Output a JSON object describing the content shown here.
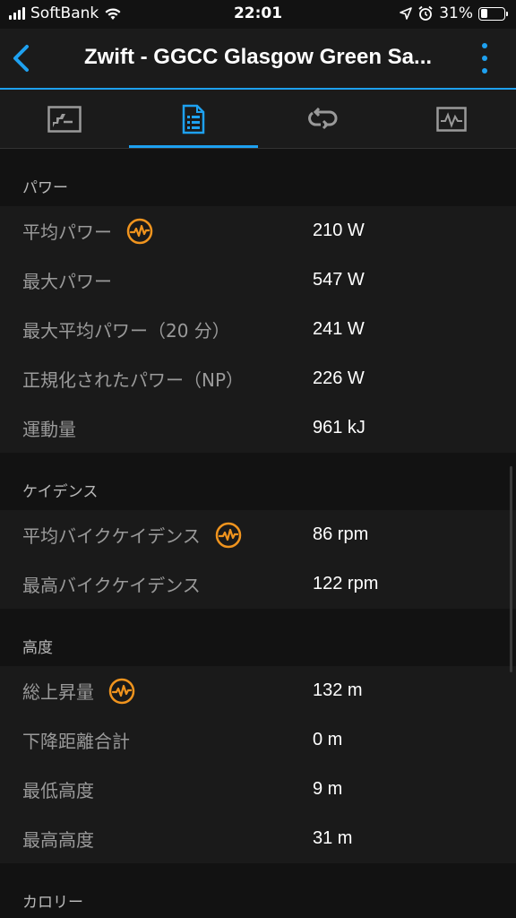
{
  "status_bar": {
    "carrier": "SoftBank",
    "time": "22:01",
    "battery_percent": "31%",
    "battery_level": 0.31
  },
  "nav": {
    "title": "Zwift -  GGCC Glasgow Green Sa..."
  },
  "tabs": [
    {
      "name": "summary-chart",
      "icon": "chart-icon"
    },
    {
      "name": "stats",
      "icon": "list-document-icon",
      "active": true
    },
    {
      "name": "laps",
      "icon": "loop-icon"
    },
    {
      "name": "graph",
      "icon": "pulse-graph-icon"
    }
  ],
  "sections": [
    {
      "title": "パワー",
      "rows": [
        {
          "label": "平均パワー",
          "value": "210 W",
          "badge": true
        },
        {
          "label": "最大パワー",
          "value": "547 W"
        },
        {
          "label": "最大平均パワー（20 分）",
          "value": "241 W"
        },
        {
          "label": "正規化されたパワー（NP）",
          "value": "226 W"
        },
        {
          "label": "運動量",
          "value": "961 kJ"
        }
      ]
    },
    {
      "title": "ケイデンス",
      "rows": [
        {
          "label": "平均バイクケイデンス",
          "value": "86 rpm",
          "badge": true
        },
        {
          "label": "最高バイクケイデンス",
          "value": "122 rpm"
        }
      ]
    },
    {
      "title": "高度",
      "rows": [
        {
          "label": "総上昇量",
          "value": "132 m",
          "badge": true
        },
        {
          "label": "下降距離合計",
          "value": "0 m"
        },
        {
          "label": "最低高度",
          "value": "9 m"
        },
        {
          "label": "最高高度",
          "value": "31 m"
        }
      ]
    },
    {
      "title": "カロリー",
      "rows": []
    }
  ],
  "colors": {
    "accent": "#1ea1f0",
    "badge": "#f0941e",
    "background": "#121212",
    "row_background": "#1a1a1a"
  }
}
